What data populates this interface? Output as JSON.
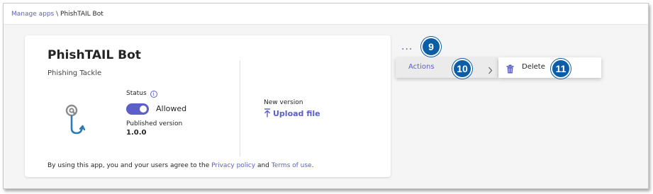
{
  "breadcrumb": {
    "parent": "Manage apps",
    "separator": "\\",
    "current": "PhishTAIL Bot"
  },
  "app": {
    "name": "PhishTAIL Bot",
    "publisher": "Phishing Tackle",
    "logo_icon": "at-sign-fish-hook-icon",
    "status": {
      "label": "Status",
      "info_glyph": "i",
      "toggle_on": true,
      "value": "Allowed"
    },
    "published_version": {
      "label": "Published version",
      "value": "1.0.0"
    },
    "new_version": {
      "label": "New version",
      "upload_label": "Upload file"
    },
    "footer": {
      "prefix": "By using this app, you and your users agree to the ",
      "privacy_link": "Privacy policy",
      "conjunction": " and ",
      "terms_link": "Terms of use",
      "suffix": "."
    }
  },
  "more_menu": {
    "dots": "...",
    "actions_label": "Actions",
    "submenu": {
      "delete_label": "Delete"
    }
  },
  "callouts": [
    "9",
    "10",
    "11"
  ],
  "colors": {
    "accent": "#5b5fc7",
    "callout": "#0b5da6",
    "logo": "#2b7bb9"
  }
}
